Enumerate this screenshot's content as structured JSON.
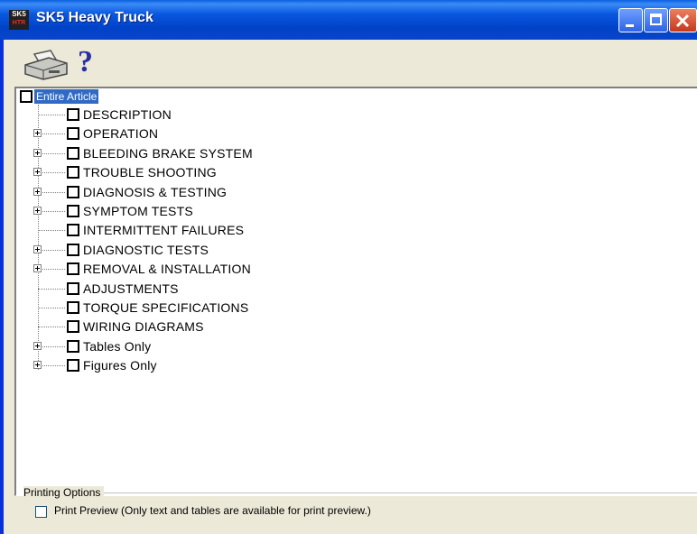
{
  "window": {
    "title": "SK5 Heavy Truck",
    "icon": {
      "top": "SK5",
      "bottom": "HTR"
    }
  },
  "toolbar": {
    "print_icon": "printer-icon",
    "help_icon_glyph": "?"
  },
  "tree": {
    "root_label": "Entire Article",
    "items": [
      {
        "label": "DESCRIPTION",
        "expandable": false
      },
      {
        "label": "OPERATION",
        "expandable": true
      },
      {
        "label": "BLEEDING BRAKE SYSTEM",
        "expandable": true
      },
      {
        "label": "TROUBLE SHOOTING",
        "expandable": true
      },
      {
        "label": "DIAGNOSIS & TESTING",
        "expandable": true
      },
      {
        "label": "SYMPTOM TESTS",
        "expandable": true
      },
      {
        "label": "INTERMITTENT FAILURES",
        "expandable": false
      },
      {
        "label": "DIAGNOSTIC TESTS",
        "expandable": true
      },
      {
        "label": "REMOVAL & INSTALLATION",
        "expandable": true
      },
      {
        "label": "ADJUSTMENTS",
        "expandable": false
      },
      {
        "label": "TORQUE SPECIFICATIONS",
        "expandable": false
      },
      {
        "label": "WIRING DIAGRAMS",
        "expandable": false
      },
      {
        "label": "Tables Only",
        "expandable": true
      },
      {
        "label": "Figures Only",
        "expandable": true
      }
    ]
  },
  "printing_options": {
    "group_label": "Printing Options",
    "print_preview_label": "Print Preview  (Only text and tables are available for print preview.)",
    "print_preview_checked": false
  },
  "colors": {
    "titlebar": "#0a58e0",
    "selection": "#316ac5",
    "face": "#ece9d8"
  }
}
